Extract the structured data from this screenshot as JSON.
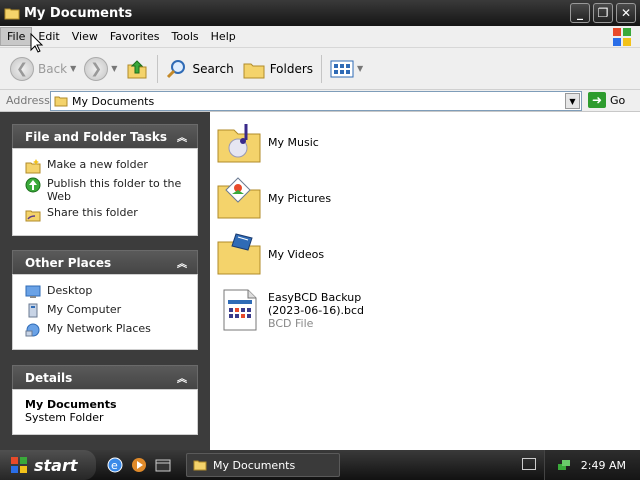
{
  "window": {
    "title": "My Documents",
    "buttons": {
      "minimize": "_",
      "restore": "❐",
      "close": "✕"
    }
  },
  "menu": {
    "items": [
      "File",
      "Edit",
      "View",
      "Favorites",
      "Tools",
      "Help"
    ]
  },
  "toolbar": {
    "back_label": "Back",
    "search_label": "Search",
    "folders_label": "Folders"
  },
  "address": {
    "label": "Address",
    "value": "My Documents",
    "go_label": "Go"
  },
  "panes": {
    "file_tasks": {
      "title": "File and Folder Tasks",
      "items": [
        {
          "label": "Make a new folder",
          "icon": "new-folder-icon"
        },
        {
          "label": "Publish this folder to the Web",
          "icon": "globe-icon"
        },
        {
          "label": "Share this folder",
          "icon": "share-folder-icon"
        }
      ]
    },
    "other_places": {
      "title": "Other Places",
      "items": [
        {
          "label": "Desktop",
          "icon": "desktop-icon"
        },
        {
          "label": "My Computer",
          "icon": "computer-icon"
        },
        {
          "label": "My Network Places",
          "icon": "network-icon"
        }
      ]
    },
    "details": {
      "title": "Details",
      "name": "My Documents",
      "type": "System Folder"
    }
  },
  "content": {
    "items": [
      {
        "name": "My Music",
        "icon": "music-folder-icon"
      },
      {
        "name": "My Pictures",
        "icon": "pictures-folder-icon"
      },
      {
        "name": "My Videos",
        "icon": "videos-folder-icon"
      },
      {
        "name_line1": "EasyBCD Backup",
        "name_line2": "(2023-06-16).bcd",
        "type": "BCD File",
        "icon": "bcd-file-icon"
      }
    ]
  },
  "taskbar": {
    "start_label": "start",
    "window_button": "My Documents",
    "clock": "2:49 AM"
  }
}
